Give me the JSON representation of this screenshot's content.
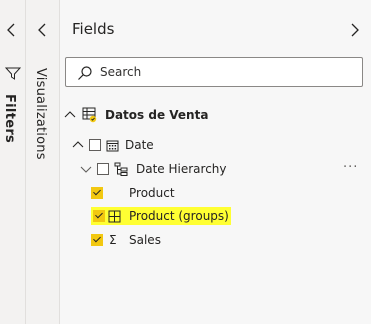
{
  "filters": {
    "label": "Filters",
    "collapse_icon": "chevron-left-icon",
    "funnel_icon": "funnel-icon"
  },
  "visualizations": {
    "label": "Visualizations",
    "collapse_icon": "chevron-left-icon"
  },
  "fields": {
    "title": "Fields",
    "expand_icon": "chevron-right-icon",
    "search": {
      "placeholder": "Search",
      "value": ""
    },
    "table": {
      "name": "Datos de Venta",
      "icon": "table-icon",
      "expanded": true,
      "items": [
        {
          "label": "Date",
          "icon": "calendar-icon",
          "checked": false,
          "expanded": true,
          "children": [
            {
              "label": "Date Hierarchy",
              "icon": "hierarchy-icon",
              "checked": false,
              "expanded": true,
              "more": "···"
            }
          ]
        },
        {
          "label": "Product",
          "icon": "",
          "checked": true
        },
        {
          "label": "Product (groups)",
          "icon": "group-icon",
          "checked": true,
          "highlighted": true
        },
        {
          "label": "Sales",
          "icon": "sigma-icon",
          "checked": true
        }
      ]
    }
  },
  "colors": {
    "accent_yellow": "#f2c811",
    "highlight": "#ffff33"
  }
}
